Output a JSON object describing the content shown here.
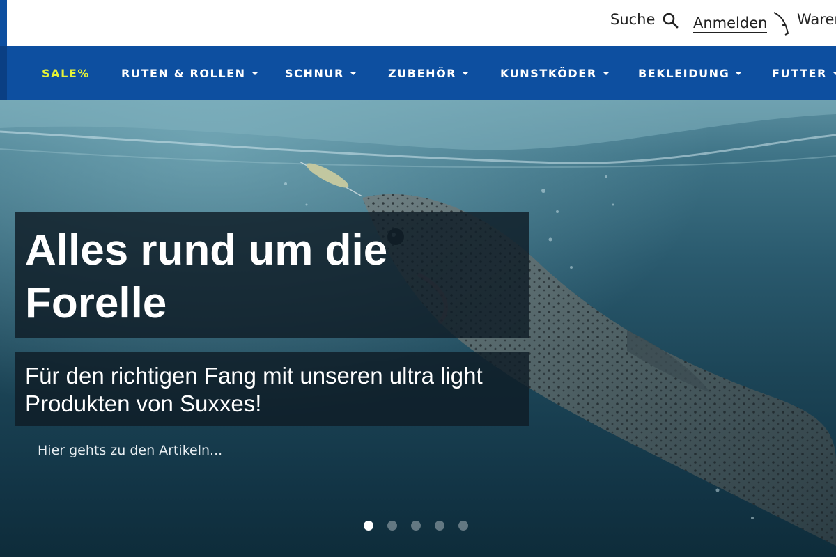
{
  "header": {
    "search_label": "Suche",
    "login_label": "Anmelden",
    "cart_label": "Waren"
  },
  "nav": {
    "items": [
      {
        "label": "SALE%",
        "dropdown": false
      },
      {
        "label": "RUTEN & ROLLEN",
        "dropdown": true
      },
      {
        "label": "SCHNUR",
        "dropdown": true
      },
      {
        "label": "ZUBEHÖR",
        "dropdown": true
      },
      {
        "label": "KUNSTKÖDER",
        "dropdown": true
      },
      {
        "label": "BEKLEIDUNG",
        "dropdown": true
      },
      {
        "label": "FUTTER",
        "dropdown": true
      }
    ]
  },
  "hero": {
    "title": "Alles rund um die Forelle",
    "subtitle": "Für den richtigen Fang mit unseren ultra light Produkten von Suxxes!",
    "link_label": "Hier gehts zu den Artikeln...",
    "slide_count": 5,
    "active_slide": 1
  },
  "colors": {
    "nav_background": "#0d4fa0",
    "sale_highlight": "#e5f237",
    "caption_background": "#0f1c26"
  }
}
